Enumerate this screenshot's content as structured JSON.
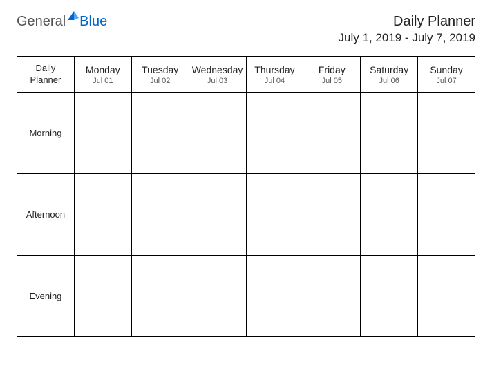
{
  "logo": {
    "text_general": "General",
    "text_blue": "Blue"
  },
  "header": {
    "title": "Daily Planner",
    "date_range": "July 1, 2019 - July 7, 2019"
  },
  "corner": {
    "line1": "Daily",
    "line2": "Planner"
  },
  "days": [
    {
      "name": "Monday",
      "date": "Jul 01"
    },
    {
      "name": "Tuesday",
      "date": "Jul 02"
    },
    {
      "name": "Wednesday",
      "date": "Jul 03"
    },
    {
      "name": "Thursday",
      "date": "Jul 04"
    },
    {
      "name": "Friday",
      "date": "Jul 05"
    },
    {
      "name": "Saturday",
      "date": "Jul 06"
    },
    {
      "name": "Sunday",
      "date": "Jul 07"
    }
  ],
  "periods": [
    "Morning",
    "Afternoon",
    "Evening"
  ]
}
